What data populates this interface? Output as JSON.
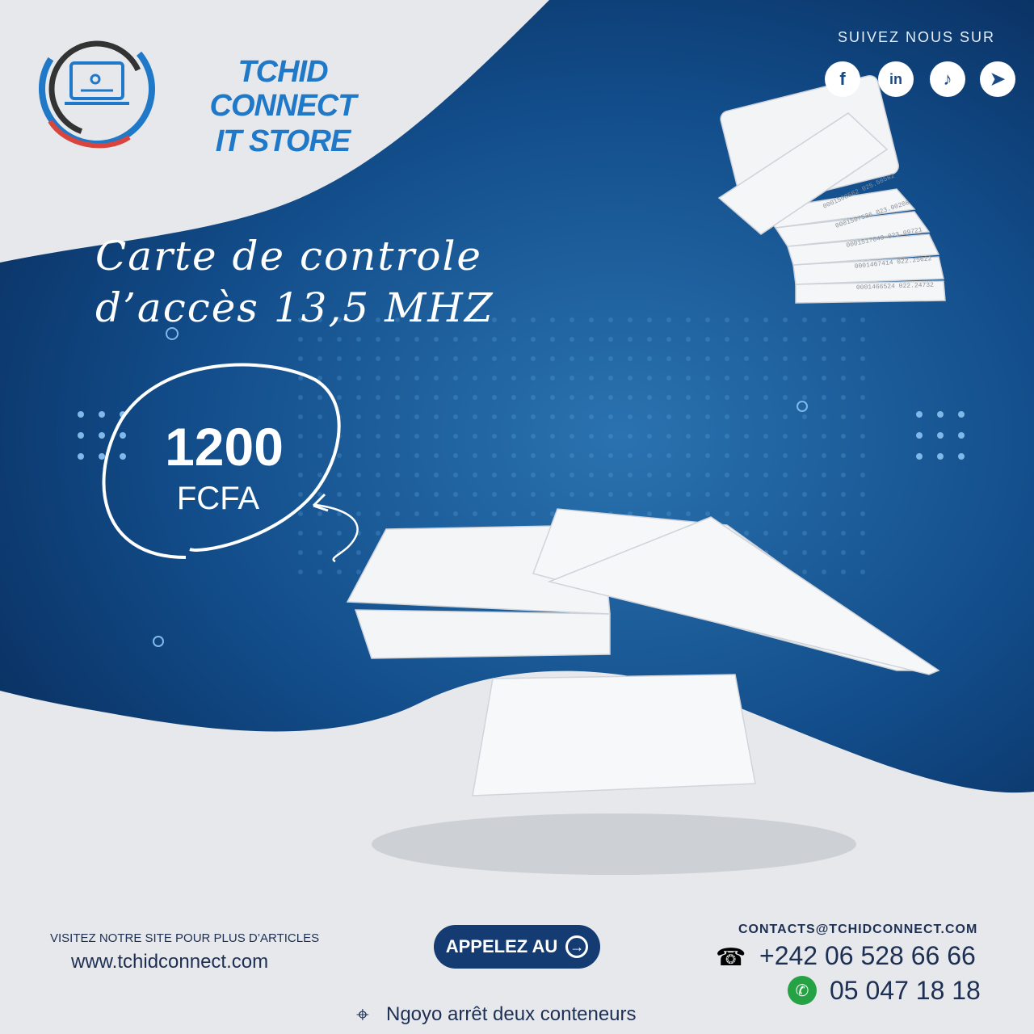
{
  "brand": {
    "line1": "TCHID CONNECT",
    "line2": "IT STORE"
  },
  "social": {
    "heading": "SUIVEZ NOUS SUR",
    "facebook": "f",
    "linkedin": "in",
    "tiktok": "♪",
    "telegram": "➤"
  },
  "product": {
    "title_line1": "Carte de controle",
    "title_line2": "d’accès 13,5 MHZ"
  },
  "price": {
    "amount": "1200",
    "currency": "FCFA"
  },
  "footer": {
    "visit_text": "VISITEZ NOTRE SITE POUR PLUS D’ARTICLES",
    "website": "www.tchidconnect.com",
    "call_label": "APPELEZ AU",
    "email": "CONTACTS@TCHIDCONNECT.COM",
    "phone": "+242 06 528 66 66",
    "whatsapp": "05 047 18 18",
    "address": "Ngoyo arrêt deux conteneurs"
  },
  "card_serials": [
    "0001466524 022.24732",
    "0001467414 022.25622",
    "0001517049 023.09721",
    "0001507536 023.00208",
    "0001508562 025.50582"
  ],
  "colors": {
    "primary": "#0f4a86",
    "dark_blue": "#0b2f5c",
    "brand_blue": "#1f78c8",
    "light_bg": "#e6e8ec"
  }
}
